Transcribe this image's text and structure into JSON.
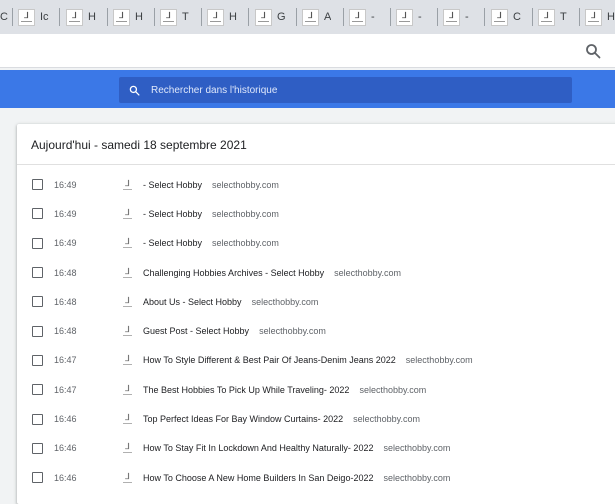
{
  "tabs": [
    {
      "title": "C",
      "favicon_glyph": ""
    },
    {
      "title": "Ic",
      "favicon_glyph": "⅃"
    },
    {
      "title": "H",
      "favicon_glyph": "⅃"
    },
    {
      "title": "H",
      "favicon_glyph": "⅃"
    },
    {
      "title": "T",
      "favicon_glyph": "⅃"
    },
    {
      "title": "H",
      "favicon_glyph": "⅃"
    },
    {
      "title": "G",
      "favicon_glyph": "⅃"
    },
    {
      "title": "A",
      "favicon_glyph": "⅃"
    },
    {
      "title": "-",
      "favicon_glyph": "⅃"
    },
    {
      "title": "-",
      "favicon_glyph": "⅃"
    },
    {
      "title": "-",
      "favicon_glyph": "⅃"
    },
    {
      "title": "C",
      "favicon_glyph": "⅃"
    },
    {
      "title": "T",
      "favicon_glyph": "⅃"
    },
    {
      "title": "H",
      "favicon_glyph": "⅃"
    }
  ],
  "history": {
    "search_placeholder": "Rechercher dans l'historique",
    "day_header": "Aujourd'hui - samedi 18 septembre 2021",
    "entries": [
      {
        "time": "16:49",
        "title": "- Select Hobby",
        "domain": "selecthobby.com"
      },
      {
        "time": "16:49",
        "title": "- Select Hobby",
        "domain": "selecthobby.com"
      },
      {
        "time": "16:49",
        "title": "- Select Hobby",
        "domain": "selecthobby.com"
      },
      {
        "time": "16:48",
        "title": "Challenging Hobbies Archives - Select Hobby",
        "domain": "selecthobby.com"
      },
      {
        "time": "16:48",
        "title": "About Us - Select Hobby",
        "domain": "selecthobby.com"
      },
      {
        "time": "16:48",
        "title": "Guest Post - Select Hobby",
        "domain": "selecthobby.com"
      },
      {
        "time": "16:47",
        "title": "How To Style Different & Best Pair Of Jeans-Denim Jeans 2022",
        "domain": "selecthobby.com"
      },
      {
        "time": "16:47",
        "title": "The Best Hobbies To Pick Up While Traveling- 2022",
        "domain": "selecthobby.com"
      },
      {
        "time": "16:46",
        "title": "Top Perfect Ideas For Bay Window Curtains- 2022",
        "domain": "selecthobby.com"
      },
      {
        "time": "16:46",
        "title": "How To Stay Fit In Lockdown And Healthy Naturally- 2022",
        "domain": "selecthobby.com"
      },
      {
        "time": "16:46",
        "title": "How To Choose A New Home Builders In San Deigo-2022",
        "domain": "selecthobby.com"
      }
    ]
  },
  "icons": {
    "toolbar": "search-icon",
    "history_search": "search-icon",
    "favicon": "select-hobby-favicon-icon"
  },
  "colors": {
    "header_blue": "#3b78e7",
    "search_box_blue": "#2f5ec4",
    "tabstrip": "#dee1e6",
    "page_background": "#f1f3f4"
  }
}
